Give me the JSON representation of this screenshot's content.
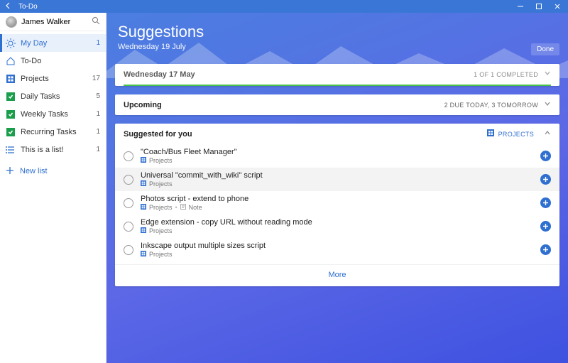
{
  "titlebar": {
    "app_name": "To-Do"
  },
  "user": {
    "name": "James Walker"
  },
  "nav": {
    "items": [
      {
        "label": "My Day",
        "count": "1",
        "icon": "sun",
        "active": true
      },
      {
        "label": "To-Do",
        "count": "",
        "icon": "home",
        "active": false
      },
      {
        "label": "Projects",
        "count": "17",
        "icon": "projects",
        "active": false
      },
      {
        "label": "Daily Tasks",
        "count": "5",
        "icon": "check",
        "active": false
      },
      {
        "label": "Weekly Tasks",
        "count": "1",
        "icon": "check",
        "active": false
      },
      {
        "label": "Recurring Tasks",
        "count": "1",
        "icon": "check",
        "active": false
      },
      {
        "label": "This is a list!",
        "count": "1",
        "icon": "list",
        "active": false
      }
    ],
    "new_list_label": "New list"
  },
  "header": {
    "title": "Suggestions",
    "subtitle": "Wednesday 19 July",
    "done_label": "Done"
  },
  "panel_completed": {
    "title": "Wednesday 17 May",
    "meta": "1 OF 1 COMPLETED"
  },
  "panel_upcoming": {
    "title": "Upcoming",
    "meta": "2 DUE TODAY, 3 TOMORROW"
  },
  "panel_suggested": {
    "title": "Suggested for you",
    "meta_label": "PROJECTS",
    "tasks": [
      {
        "title": "\"Coach/Bus Fleet Manager\"",
        "sub": "Projects",
        "note": false,
        "hover": false
      },
      {
        "title": "Universal \"commit_with_wiki\" script",
        "sub": "Projects",
        "note": false,
        "hover": true
      },
      {
        "title": "Photos script - extend to phone",
        "sub": "Projects",
        "note": true,
        "hover": false
      },
      {
        "title": "Edge extension - copy URL without reading mode",
        "sub": "Projects",
        "note": false,
        "hover": false
      },
      {
        "title": "Inkscape output multiple sizes script",
        "sub": "Projects",
        "note": false,
        "hover": false
      }
    ],
    "note_label": "Note",
    "more_label": "More"
  }
}
